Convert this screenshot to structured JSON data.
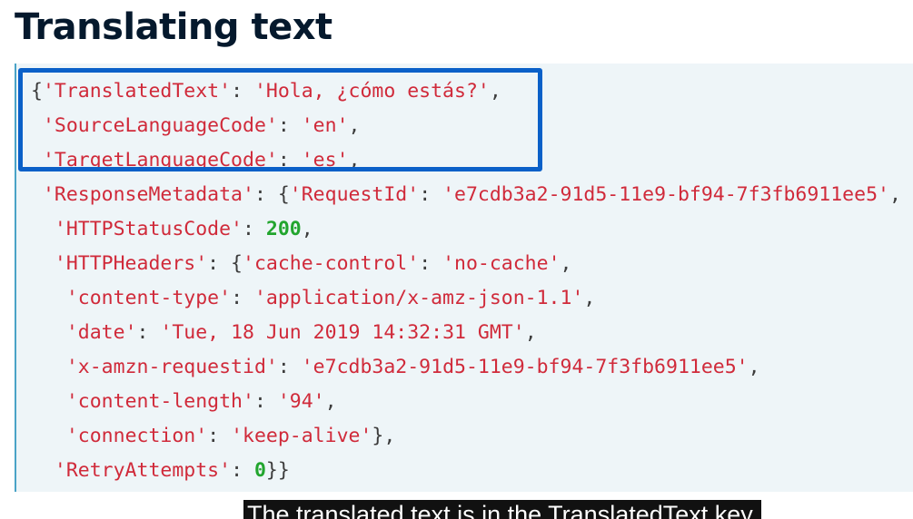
{
  "page": {
    "title": "Translating text"
  },
  "code": {
    "lines": [
      [
        {
          "t": "p",
          "v": "{"
        },
        {
          "t": "k",
          "v": "'TranslatedText'"
        },
        {
          "t": "p",
          "v": ": "
        },
        {
          "t": "s",
          "v": "'Hola, ¿cómo estás?'"
        },
        {
          "t": "p",
          "v": ","
        }
      ],
      [
        {
          "t": "p",
          "v": " "
        },
        {
          "t": "k",
          "v": "'SourceLanguageCode'"
        },
        {
          "t": "p",
          "v": ": "
        },
        {
          "t": "s",
          "v": "'en'"
        },
        {
          "t": "p",
          "v": ","
        }
      ],
      [
        {
          "t": "p",
          "v": " "
        },
        {
          "t": "k",
          "v": "'TargetLanguageCode'"
        },
        {
          "t": "p",
          "v": ": "
        },
        {
          "t": "s",
          "v": "'es'"
        },
        {
          "t": "p",
          "v": ","
        }
      ],
      [
        {
          "t": "p",
          "v": " "
        },
        {
          "t": "k",
          "v": "'ResponseMetadata'"
        },
        {
          "t": "p",
          "v": ": {"
        },
        {
          "t": "k",
          "v": "'RequestId'"
        },
        {
          "t": "p",
          "v": ": "
        },
        {
          "t": "s",
          "v": "'e7cdb3a2-91d5-11e9-bf94-7f3fb6911ee5'"
        },
        {
          "t": "p",
          "v": ","
        }
      ],
      [
        {
          "t": "p",
          "v": "  "
        },
        {
          "t": "k",
          "v": "'HTTPStatusCode'"
        },
        {
          "t": "p",
          "v": ": "
        },
        {
          "t": "n",
          "v": "200"
        },
        {
          "t": "p",
          "v": ","
        }
      ],
      [
        {
          "t": "p",
          "v": "  "
        },
        {
          "t": "k",
          "v": "'HTTPHeaders'"
        },
        {
          "t": "p",
          "v": ": {"
        },
        {
          "t": "k",
          "v": "'cache-control'"
        },
        {
          "t": "p",
          "v": ": "
        },
        {
          "t": "s",
          "v": "'no-cache'"
        },
        {
          "t": "p",
          "v": ","
        }
      ],
      [
        {
          "t": "p",
          "v": "   "
        },
        {
          "t": "k",
          "v": "'content-type'"
        },
        {
          "t": "p",
          "v": ": "
        },
        {
          "t": "s",
          "v": "'application/x-amz-json-1.1'"
        },
        {
          "t": "p",
          "v": ","
        }
      ],
      [
        {
          "t": "p",
          "v": "   "
        },
        {
          "t": "k",
          "v": "'date'"
        },
        {
          "t": "p",
          "v": ": "
        },
        {
          "t": "s",
          "v": "'Tue, 18 Jun 2019 14:32:31 GMT'"
        },
        {
          "t": "p",
          "v": ","
        }
      ],
      [
        {
          "t": "p",
          "v": "   "
        },
        {
          "t": "k",
          "v": "'x-amzn-requestid'"
        },
        {
          "t": "p",
          "v": ": "
        },
        {
          "t": "s",
          "v": "'e7cdb3a2-91d5-11e9-bf94-7f3fb6911ee5'"
        },
        {
          "t": "p",
          "v": ","
        }
      ],
      [
        {
          "t": "p",
          "v": "   "
        },
        {
          "t": "k",
          "v": "'content-length'"
        },
        {
          "t": "p",
          "v": ": "
        },
        {
          "t": "s",
          "v": "'94'"
        },
        {
          "t": "p",
          "v": ","
        }
      ],
      [
        {
          "t": "p",
          "v": "   "
        },
        {
          "t": "k",
          "v": "'connection'"
        },
        {
          "t": "p",
          "v": ": "
        },
        {
          "t": "s",
          "v": "'keep-alive'"
        },
        {
          "t": "p",
          "v": "},"
        }
      ],
      [
        {
          "t": "p",
          "v": "  "
        },
        {
          "t": "k",
          "v": "'RetryAttempts'"
        },
        {
          "t": "p",
          "v": ": "
        },
        {
          "t": "n",
          "v": "0"
        },
        {
          "t": "p",
          "v": "}}"
        }
      ]
    ]
  },
  "caption": {
    "text": "The translated text is in the TranslatedText key."
  },
  "colors": {
    "title": "#05192d",
    "code_background": "#eef5f8",
    "code_left_border": "#4aa3c7",
    "string": "#d02a3a",
    "number": "#22a52e",
    "punctuation": "#3c3c3c",
    "highlight_box": "#0a60c8",
    "caption_background": "#111111",
    "caption_text": "#ffffff"
  }
}
